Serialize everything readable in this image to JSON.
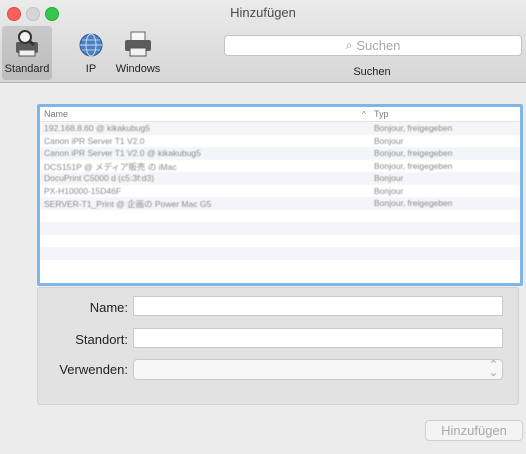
{
  "window": {
    "title": "Hinzufügen"
  },
  "toolbar": {
    "buttons": [
      {
        "label": "Standard",
        "icon": "printer-magnifier-icon",
        "selected": true
      },
      {
        "label": "IP",
        "icon": "globe-icon",
        "selected": false
      },
      {
        "label": "Windows",
        "icon": "printer-icon",
        "selected": false
      }
    ],
    "search": {
      "placeholder": "Suchen",
      "label": "Suchen"
    }
  },
  "table": {
    "columns": {
      "name": "Name",
      "type": "Typ"
    },
    "rows": [
      {
        "name": "192.168.8.60 @ kikakubug5",
        "type": "Bonjour, freigegeben"
      },
      {
        "name": "Canon iPR Server T1 V2.0",
        "type": "Bonjour"
      },
      {
        "name": "Canon iPR Server T1 V2.0 @ kikakubug5",
        "type": "Bonjour, freigegeben"
      },
      {
        "name": "DCS151P @ メディア販売 の iMac",
        "type": "Bonjour, freigegeben"
      },
      {
        "name": "DocuPrint C5000 d (c5:3f:d3)",
        "type": "Bonjour"
      },
      {
        "name": "PX-H10000-15D46F",
        "type": "Bonjour"
      },
      {
        "name": "SERVER-T1_Print @ 企画の Power Mac G5",
        "type": "Bonjour, freigegeben"
      }
    ]
  },
  "form": {
    "name_label": "Name:",
    "name_value": "",
    "location_label": "Standort:",
    "location_value": "",
    "use_label": "Verwenden:",
    "use_value": ""
  },
  "actions": {
    "add_label": "Hinzufügen"
  },
  "colors": {
    "accent": "#80b5ea",
    "close": "#fc605c",
    "maximize": "#34c84a"
  }
}
